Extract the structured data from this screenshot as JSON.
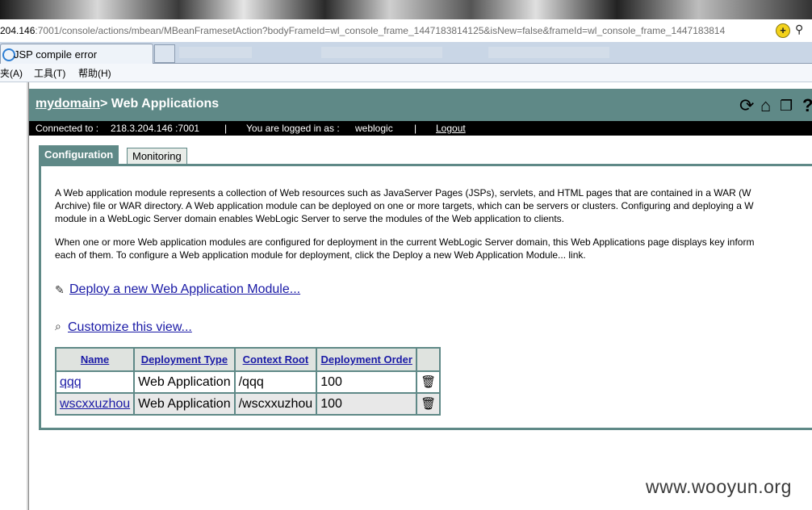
{
  "browser": {
    "url_host": "204.146",
    "url_rest": ":7001/console/actions/mbean/MBeanFramesetAction?bodyFrameId=wl_console_frame_1447183814125&isNew=false&frameId=wl_console_frame_1447183814",
    "tab_title": "JSP compile error",
    "menu": [
      "夹(A)",
      "工具(T)",
      "帮助(H)"
    ]
  },
  "header": {
    "domain_link": "mydomain",
    "title": "> Web Applications",
    "icons": [
      "refresh-icon",
      "home-icon",
      "windows-icon",
      "help-icon"
    ]
  },
  "status": {
    "connected_label": "Connected to :",
    "connected_value": "218.3.204.146 :7001",
    "sep": "|",
    "logged_label": "You are logged in as :",
    "logged_value": "weblogic",
    "logout": "Logout"
  },
  "tabs": {
    "configuration": "Configuration",
    "monitoring": "Monitoring"
  },
  "description": {
    "p1_l1": "A Web application module represents a collection of Web resources such as JavaServer Pages (JSPs), servlets, and HTML pages that are contained in a WAR (W",
    "p1_l2": "Archive) file or WAR directory. A Web application module can be deployed on one or more targets, which can be servers or clusters. Configuring and deploying a W",
    "p1_l3": "module in a WebLogic Server domain enables WebLogic Server to serve the modules of the Web application to clients.",
    "p2_l1": "When one or more Web application modules are configured for deployment in the current WebLogic Server domain, this Web Applications page displays key inform",
    "p2_l2": "each of them. To configure a Web application module for deployment, click the Deploy a new Web Application Module... link."
  },
  "actions": {
    "deploy": "Deploy a new Web Application Module...",
    "customize": "Customize this view..."
  },
  "table": {
    "headers": [
      "Name",
      "Deployment Type",
      "Context Root",
      "Deployment Order",
      ""
    ],
    "rows": [
      {
        "name": "qqq",
        "type": "Web Application",
        "context": "/qqq",
        "order": "100"
      },
      {
        "name": "wscxxuzhou",
        "type": "Web Application",
        "context": "/wscxxuzhou",
        "order": "100"
      }
    ]
  },
  "watermark": "www.wooyun.org"
}
